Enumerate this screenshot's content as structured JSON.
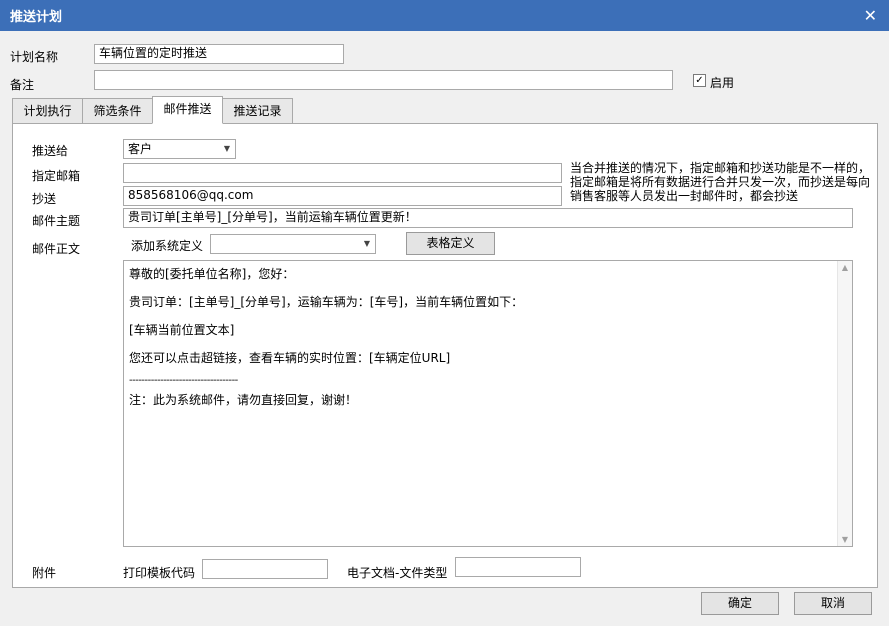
{
  "window": {
    "title": "推送计划",
    "close_icon": "✕"
  },
  "plan": {
    "name_label": "计划名称",
    "name_value": "车辆位置的定时推送",
    "remark_label": "备注",
    "remark_value": "",
    "enable_check": "✓",
    "enable_label": "启用"
  },
  "tabs": [
    {
      "label": "计划执行"
    },
    {
      "label": "筛选条件"
    },
    {
      "label": "邮件推送"
    },
    {
      "label": "推送记录"
    }
  ],
  "email": {
    "send_to_label": "推送给",
    "send_to_value": "客户",
    "dropdown_arrow": "▼",
    "assigned_email_label": "指定邮箱",
    "assigned_email_value": "",
    "cc_label": "抄送",
    "cc_value": "858568106@qq.com",
    "note_lines": [
      "当合并推送的情况下，指定邮箱和抄送功能是不一样的，",
      "指定邮箱是将所有数据进行合并只发一次，而抄送是每向",
      "销售客服等人员发出一封邮件时，都会抄送"
    ],
    "subject_label": "邮件主题",
    "subject_value": "贵司订单[主单号]_[分单号]，当前运输车辆位置更新！",
    "body_label": "邮件正文",
    "add_system_def_label": "添加系统定义",
    "add_system_def_value": "",
    "table_def_button": "表格定义",
    "body_lines": [
      "尊敬的[委托单位名称]，您好：",
      "贵司订单：[主单号]_[分单号]，运输车辆为：[车号]，当前车辆位置如下：",
      "[车辆当前位置文本]",
      "您还可以点击超链接，查看车辆的实时位置：[车辆定位URL]",
      "-----------------------------------",
      "注：此为系统邮件，请勿直接回复，谢谢！"
    ],
    "scroll_up": "▲",
    "scroll_down": "▼",
    "attachment_label": "附件",
    "print_template_label": "打印模板代码",
    "print_template_value": "",
    "doc_type_label": "电子文档-文件类型",
    "doc_type_value": ""
  },
  "footer": {
    "ok_button": "确定",
    "cancel_button": "取消"
  }
}
